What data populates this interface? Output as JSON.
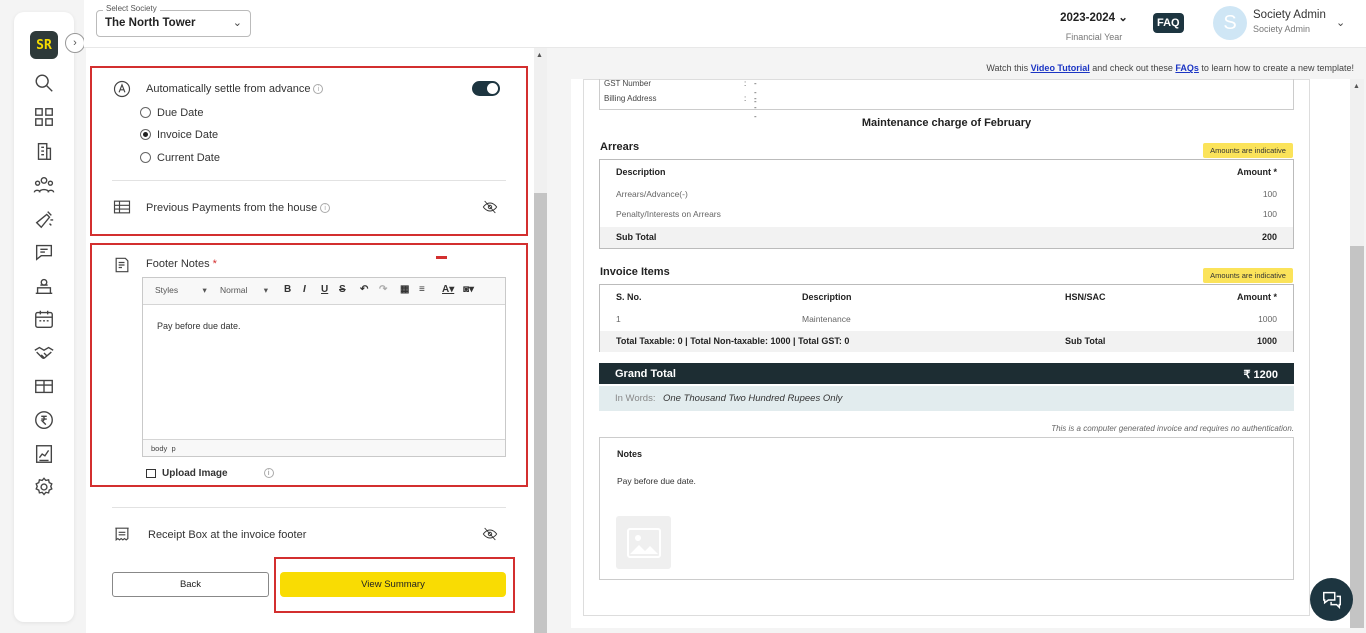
{
  "header": {
    "society_label": "Select Society",
    "society_value": "The North Tower",
    "financial_year": "2023-2024",
    "financial_year_label": "Financial Year",
    "faq": "FAQ",
    "avatar_initial": "S",
    "user_name": "Society Admin",
    "user_role": "Society Admin"
  },
  "sidebar": {
    "logo": "SR",
    "items": [
      "search-icon",
      "dashboard-icon",
      "building-icon",
      "members-icon",
      "broadcast-icon",
      "chat-icon",
      "helpdesk-icon",
      "calendar-icon",
      "handshake-icon",
      "amenity-icon",
      "accounts-icon",
      "reports-icon",
      "settings-icon"
    ]
  },
  "settings": {
    "auto_settle_label": "Automatically settle from advance",
    "auto_settle_enabled": true,
    "radio_options": [
      "Due Date",
      "Invoice Date",
      "Current Date"
    ],
    "radio_selected": "Invoice Date",
    "prev_payments_label": "Previous Payments from the house",
    "footer_notes_label": "Footer Notes",
    "footer_notes_required": "*",
    "editor": {
      "styles_dd": "Styles",
      "format_dd": "Normal",
      "content": "Pay before due date.",
      "status_path_1": "body",
      "status_path_2": "p"
    },
    "upload_image": "Upload Image",
    "receipt_box_label": "Receipt Box at the invoice footer",
    "back_button": "Back",
    "view_summary_button": "View Summary"
  },
  "preview": {
    "tutorial": {
      "prefix": "Watch this",
      "video_link": "Video Tutorial",
      "middle": "and check out these",
      "faq_link": "FAQs",
      "suffix": "to learn how to create a new template!"
    },
    "info_rows": [
      {
        "label": "GST Number",
        "value": "---"
      },
      {
        "label": "Billing Address",
        "value": "---"
      }
    ],
    "title": "Maintenance charge of February",
    "indicative_badge": "Amounts are indicative",
    "arrears": {
      "title": "Arrears",
      "headers": {
        "description": "Description",
        "amount": "Amount *"
      },
      "rows": [
        {
          "description": "Arrears/Advance(-)",
          "amount": "100"
        },
        {
          "description": "Penalty/Interests on Arrears",
          "amount": "100"
        }
      ],
      "subtotal_label": "Sub Total",
      "subtotal_value": "200"
    },
    "invoice_items": {
      "title": "Invoice Items",
      "headers": {
        "sno": "S. No.",
        "description": "Description",
        "hsn": "HSN/SAC",
        "amount": "Amount *"
      },
      "rows": [
        {
          "sno": "1",
          "description": "Maintenance",
          "hsn": "",
          "amount": "1000"
        }
      ],
      "totals_text": "Total Taxable: 0 | Total Non-taxable: 1000 | Total GST: 0",
      "subtotal_label": "Sub Total",
      "subtotal_value": "1000"
    },
    "grand_total_label": "Grand Total",
    "grand_total_value": "₹ 1200",
    "in_words_label": "In Words:",
    "in_words_value": "One Thousand Two Hundred Rupees Only",
    "auth_note": "This is a computer generated invoice and requires no authentication.",
    "notes_title": "Notes",
    "notes_text": "Pay before due date."
  },
  "colors": {
    "accent_yellow": "#f9dc03",
    "dark_teal": "#1d3540",
    "highlight_red": "#d32f2f"
  }
}
